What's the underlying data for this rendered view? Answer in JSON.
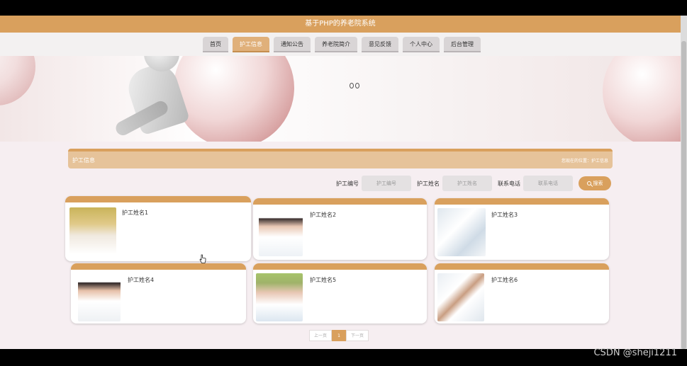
{
  "header": {
    "title": "基于PHP的养老院系统"
  },
  "nav": {
    "items": [
      {
        "label": "首页",
        "active": false
      },
      {
        "label": "护工信息",
        "active": true
      },
      {
        "label": "通知公告",
        "active": false
      },
      {
        "label": "养老院简介",
        "active": false
      },
      {
        "label": "意见反馈",
        "active": false
      },
      {
        "label": "个人中心",
        "active": false
      },
      {
        "label": "后台管理",
        "active": false
      }
    ]
  },
  "panel": {
    "title": "护工信息",
    "breadcrumb": "您现在的位置：护工信息"
  },
  "search": {
    "fields": [
      {
        "label": "护工编号",
        "placeholder": "护工编号"
      },
      {
        "label": "护工姓名",
        "placeholder": "护工姓名"
      },
      {
        "label": "联系电话",
        "placeholder": "联系电话"
      }
    ],
    "button_label": "搜索"
  },
  "cards": [
    {
      "name": "护工姓名1"
    },
    {
      "name": "护工姓名2"
    },
    {
      "name": "护工姓名3"
    },
    {
      "name": "护工姓名4"
    },
    {
      "name": "护工姓名5"
    },
    {
      "name": "护工姓名6"
    }
  ],
  "pagination": {
    "prev": "上一页",
    "current": "1",
    "next": "下一页"
  },
  "watermark": "CSDN @sheji1211",
  "colors": {
    "accent": "#d9a05d",
    "page_bg": "#f6eef1"
  }
}
